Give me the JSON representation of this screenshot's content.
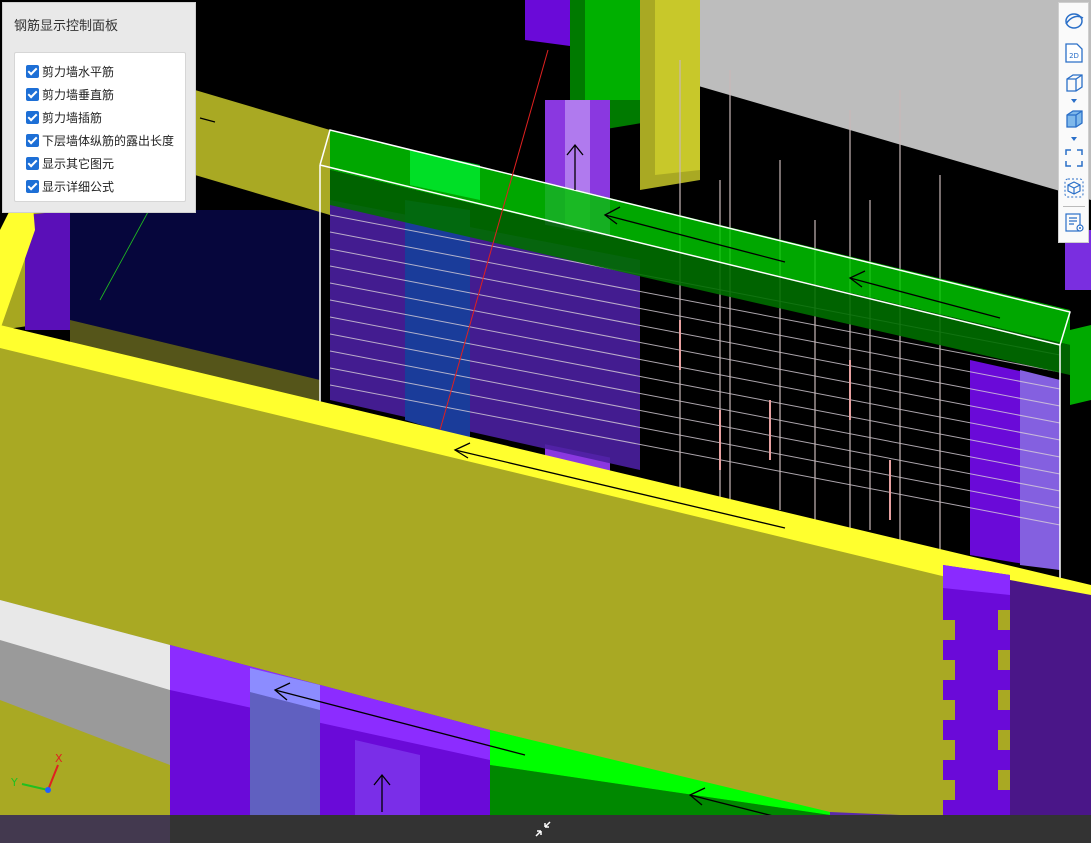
{
  "panel": {
    "title": "钢筋显示控制面板",
    "options": [
      {
        "label": "剪力墙水平筋",
        "checked": true
      },
      {
        "label": "剪力墙垂直筋",
        "checked": true
      },
      {
        "label": "剪力墙插筋",
        "checked": true
      },
      {
        "label": "下层墙体纵筋的露出长度",
        "checked": true
      },
      {
        "label": "显示其它图元",
        "checked": true
      },
      {
        "label": "显示详细公式",
        "checked": true
      }
    ]
  },
  "toolbar": {
    "items": [
      {
        "name": "orbit-icon"
      },
      {
        "name": "view-2d-icon",
        "label": "2D"
      },
      {
        "name": "wireframe-cube-icon"
      },
      {
        "name": "shaded-cube-icon"
      },
      {
        "name": "fullscreen-icon"
      },
      {
        "name": "region-cube-icon"
      },
      {
        "name": "properties-list-icon"
      }
    ]
  },
  "axes": {
    "x_label": "X",
    "y_label": "Y"
  },
  "colors": {
    "wall_yellow": "#a9a923",
    "wall_yellow_top": "#ffff2e",
    "column_purple": "#6a0ad8",
    "beam_green": "#00e800",
    "slab_gray": "#bdbdbd",
    "selection_outline": "#ffffff",
    "accent": "#1d6fd6"
  }
}
